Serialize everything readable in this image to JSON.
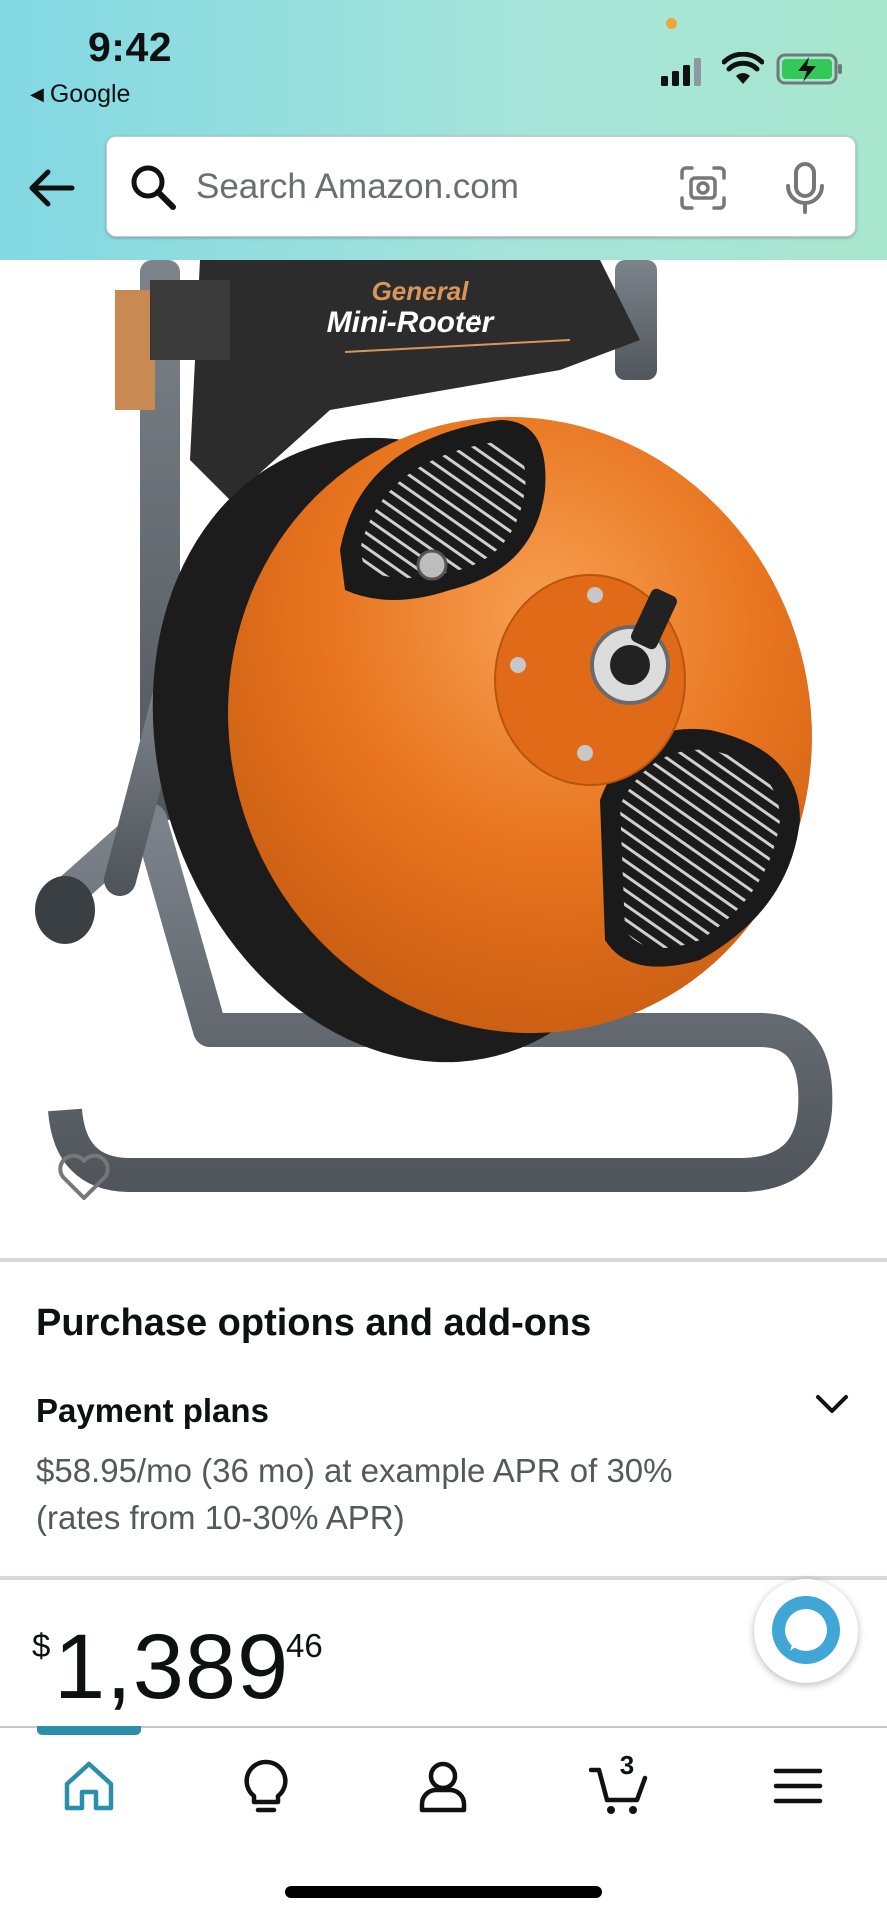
{
  "status_bar": {
    "time": "9:42",
    "back_app": "Google",
    "back_glyph": "◀"
  },
  "search": {
    "placeholder": "Search Amazon.com"
  },
  "icons": {
    "back": "back-arrow-icon",
    "search": "search-icon",
    "camera": "camera-scan-icon",
    "mic": "microphone-icon",
    "wishlist": "heart-icon",
    "expand": "chevron-down-icon",
    "alexa": "alexa-icon"
  },
  "product": {
    "image_brand": "General",
    "image_model": "Mini-Rooter",
    "image_tm": "™"
  },
  "purchase_options": {
    "title": "Purchase options and add-ons",
    "payment_plans_title": "Payment plans",
    "payment_plans_desc": "$58.95/mo (36 mo) at example APR of 30% (rates from 10-30% APR)"
  },
  "price": {
    "currency": "$",
    "whole": "1,389",
    "fraction": "46"
  },
  "bottom_nav": {
    "active": "home",
    "items": [
      "home",
      "inspire",
      "account",
      "cart",
      "menu"
    ],
    "cart_count": "3"
  },
  "colors": {
    "header_start": "#82d8e3",
    "header_end": "#a8e6cf",
    "accent": "#2a8fa8",
    "reel_orange": "#e8741f"
  }
}
